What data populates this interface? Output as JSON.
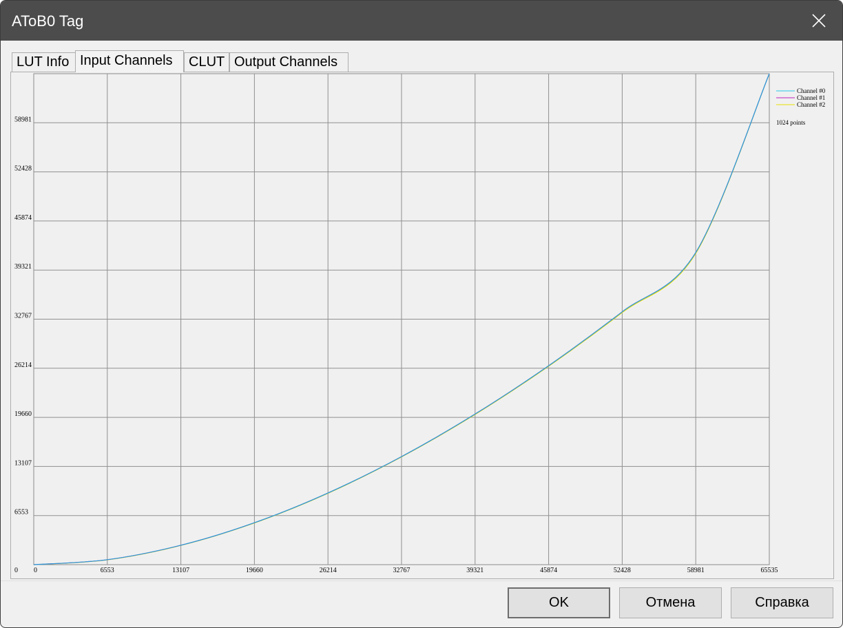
{
  "window": {
    "title": "AToB0 Tag"
  },
  "tabs": [
    {
      "label": "LUT Info",
      "active": false
    },
    {
      "label": "Input Channels",
      "active": true
    },
    {
      "label": "CLUT",
      "active": false
    },
    {
      "label": "Output Channels",
      "active": false
    }
  ],
  "buttons": {
    "ok": "OK",
    "cancel": "Отмена",
    "help": "Справка"
  },
  "chart_data": {
    "type": "line",
    "xlim": [
      0,
      65535
    ],
    "ylim": [
      0,
      65535
    ],
    "x_ticks": [
      "0",
      "6553",
      "13107",
      "19660",
      "26214",
      "32767",
      "39321",
      "45874",
      "52428",
      "58981",
      "65535"
    ],
    "y_ticks": [
      "0",
      "6553",
      "13107",
      "19660",
      "26214",
      "32767",
      "39321",
      "45874",
      "52428",
      "58981",
      "65535"
    ],
    "grid": true,
    "legend_placement": "right",
    "x": [
      0,
      6553,
      13107,
      19660,
      26214,
      32767,
      39321,
      45874,
      52428,
      58981,
      65535
    ],
    "series": [
      {
        "name": "Channel #0",
        "color": "#22c8e8",
        "values": [
          0,
          659,
          2590,
          5595,
          9568,
          14423,
          20102,
          26557,
          33754,
          41662,
          65535
        ]
      },
      {
        "name": "Channel #1",
        "color": "#c020c0",
        "values": [
          0,
          659,
          2590,
          5595,
          9568,
          14423,
          20102,
          26557,
          33754,
          41662,
          65535
        ]
      },
      {
        "name": "Channel #2",
        "color": "#e8e000",
        "values": [
          0,
          640,
          2560,
          5560,
          9520,
          14380,
          20040,
          26480,
          33650,
          41540,
          65535
        ]
      }
    ],
    "annotation": "1024 points"
  }
}
